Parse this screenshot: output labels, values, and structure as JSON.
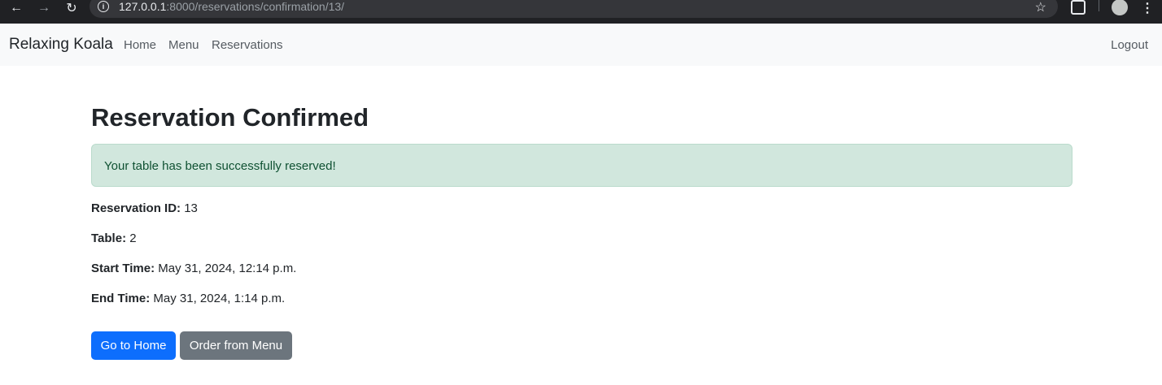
{
  "browser": {
    "url_host": "127.0.0.1",
    "url_rest": ":8000/reservations/confirmation/13/"
  },
  "navbar": {
    "brand": "Relaxing Koala",
    "links": [
      "Home",
      "Menu",
      "Reservations"
    ],
    "logout": "Logout"
  },
  "page": {
    "title": "Reservation Confirmed",
    "alert": "Your table has been successfully reserved!",
    "details": [
      {
        "label": "Reservation ID:",
        "value": " 13"
      },
      {
        "label": "Table:",
        "value": " 2"
      },
      {
        "label": "Start Time:",
        "value": " May 31, 2024, 12:14 p.m."
      },
      {
        "label": "End Time:",
        "value": " May 31, 2024, 1:14 p.m."
      }
    ],
    "buttons": {
      "home": "Go to Home",
      "menu": "Order from Menu"
    }
  },
  "colors": {
    "primary": "#0d6efd",
    "secondary": "#6c757d",
    "alert_bg": "#d1e7dd",
    "alert_text": "#0f5132"
  }
}
